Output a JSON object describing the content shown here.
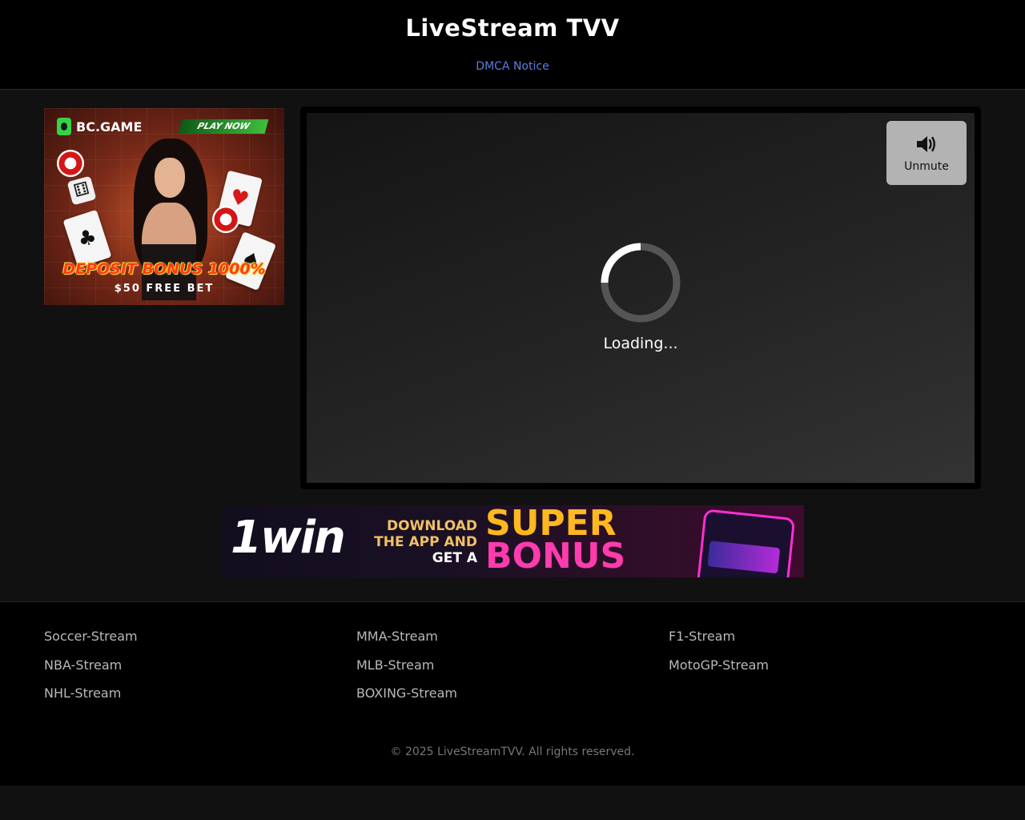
{
  "header": {
    "title": "LiveStream TVV",
    "dmca_link": "DMCA Notice"
  },
  "ads": {
    "left": {
      "brand": "BC.GAME",
      "cta": "PLAY NOW",
      "headline": "DEPOSIT BONUS 1000%",
      "subline": "$50 FREE BET"
    },
    "bottom": {
      "brand": "1win",
      "line1": "DOWNLOAD",
      "line2": "THE APP AND",
      "line3": "GET A",
      "super": "SUPER",
      "bonus": "BONUS"
    }
  },
  "player": {
    "unmute_label": "Unmute",
    "loading_text": "Loading..."
  },
  "footer": {
    "links": [
      "Soccer-Stream",
      "MMA-Stream",
      "F1-Stream",
      "NBA-Stream",
      "MLB-Stream",
      "MotoGP-Stream",
      "NHL-Stream",
      "BOXING-Stream"
    ],
    "copyright": "© 2025 LiveStreamTVV. All rights reserved."
  },
  "colors": {
    "link_blue": "#5b7fe0",
    "background": "#111111",
    "header_bg": "#000000",
    "unmute_bg": "#b3b3b3"
  }
}
